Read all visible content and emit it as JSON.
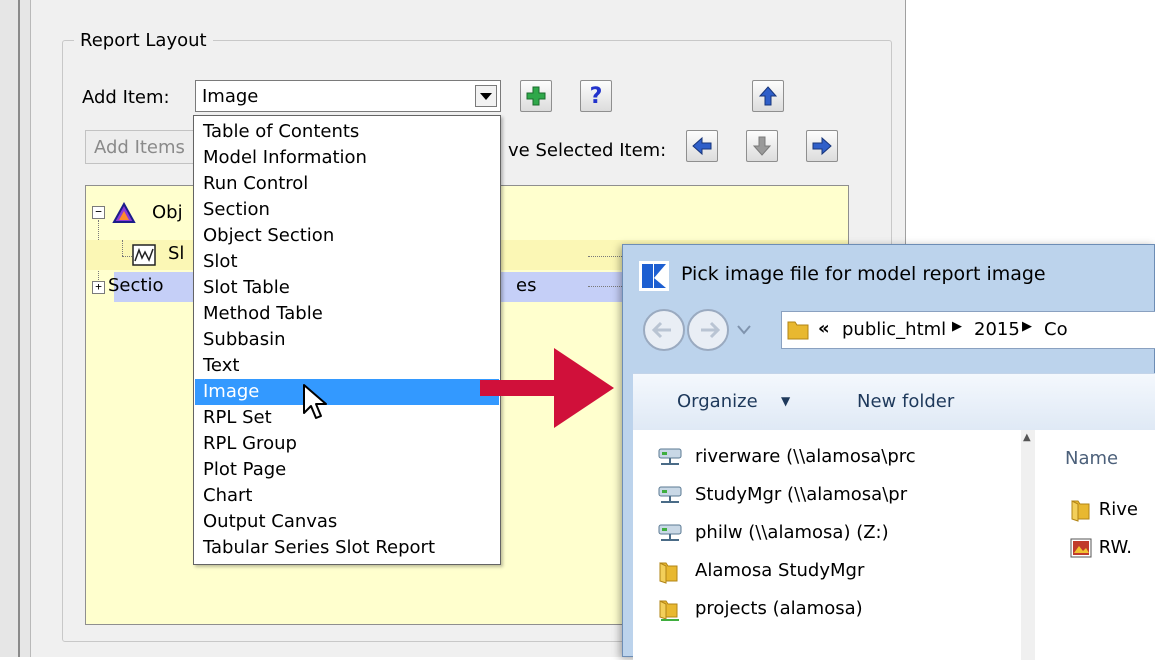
{
  "report_layout": {
    "group_title": "Report Layout",
    "add_item_label": "Add Item:",
    "add_item_value": "Image",
    "help_glyph": "?",
    "add_items_button": "Add Items",
    "move_selected_label": "ve Selected Item:"
  },
  "tree": {
    "row1": "Obj",
    "row2": "Sl",
    "row3_start": "Sectio",
    "row3_end": "es"
  },
  "dropdown": {
    "items": [
      "Table of Contents",
      "Model Information",
      "Run Control",
      "Section",
      "Object Section",
      "Slot",
      "Slot Table",
      "Method Table",
      "Subbasin",
      "Text",
      "Image",
      "RPL Set",
      "RPL Group",
      "Plot Page",
      "Chart",
      "Output Canvas",
      "Tabular Series Slot Report"
    ],
    "selected": "Image"
  },
  "dialog": {
    "title": "Pick image file for model report image",
    "path_prefix": "«",
    "path": [
      "public_html",
      "2015",
      "Co"
    ],
    "organize": "Organize",
    "new_folder": "New folder",
    "nav_items": [
      {
        "label": "riverware (\\\\alamosa\\prc",
        "icon": "network-drive-icon"
      },
      {
        "label": "StudyMgr (\\\\alamosa\\pr",
        "icon": "network-drive-icon"
      },
      {
        "label": "philw (\\\\alamosa) (Z:)",
        "icon": "network-drive-icon"
      },
      {
        "label": "Alamosa StudyMgr",
        "icon": "folder-icon"
      },
      {
        "label": "projects (alamosa)",
        "icon": "shared-folder-icon"
      }
    ],
    "files_header": "Name",
    "files": [
      {
        "label": "Rive",
        "icon": "folder-icon"
      },
      {
        "label": "RW.",
        "icon": "image-file-icon"
      }
    ]
  },
  "colors": {
    "selection": "#3399ff",
    "arrow": "#d0103a",
    "tree_bg": "#ffffce"
  }
}
